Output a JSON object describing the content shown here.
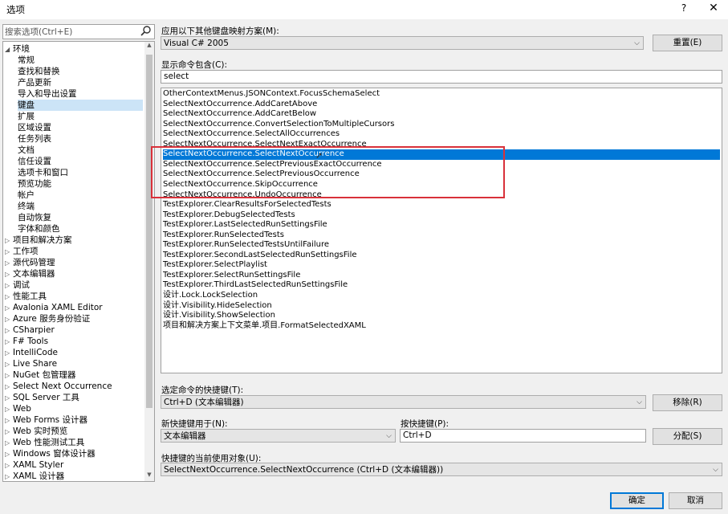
{
  "window": {
    "title": "选项",
    "help": "?",
    "close": "✕"
  },
  "search": {
    "placeholder": "搜索选项(Ctrl+E)",
    "value": "搜索选项(Ctrl+E)"
  },
  "tree": [
    {
      "label": "环境",
      "twisty": "◢",
      "indent": 0,
      "selected": false
    },
    {
      "label": "常规",
      "twisty": "",
      "indent": 1,
      "selected": false
    },
    {
      "label": "查找和替换",
      "twisty": "",
      "indent": 1,
      "selected": false
    },
    {
      "label": "产品更新",
      "twisty": "",
      "indent": 1,
      "selected": false
    },
    {
      "label": "导入和导出设置",
      "twisty": "",
      "indent": 1,
      "selected": false
    },
    {
      "label": "键盘",
      "twisty": "",
      "indent": 1,
      "selected": true
    },
    {
      "label": "扩展",
      "twisty": "",
      "indent": 1,
      "selected": false
    },
    {
      "label": "区域设置",
      "twisty": "",
      "indent": 1,
      "selected": false
    },
    {
      "label": "任务列表",
      "twisty": "",
      "indent": 1,
      "selected": false
    },
    {
      "label": "文档",
      "twisty": "",
      "indent": 1,
      "selected": false
    },
    {
      "label": "信任设置",
      "twisty": "",
      "indent": 1,
      "selected": false
    },
    {
      "label": "选项卡和窗口",
      "twisty": "",
      "indent": 1,
      "selected": false
    },
    {
      "label": "预览功能",
      "twisty": "",
      "indent": 1,
      "selected": false
    },
    {
      "label": "帐户",
      "twisty": "",
      "indent": 1,
      "selected": false
    },
    {
      "label": "终端",
      "twisty": "",
      "indent": 1,
      "selected": false
    },
    {
      "label": "自动恢复",
      "twisty": "",
      "indent": 1,
      "selected": false
    },
    {
      "label": "字体和颜色",
      "twisty": "",
      "indent": 1,
      "selected": false
    },
    {
      "label": "项目和解决方案",
      "twisty": "▷",
      "indent": 0,
      "selected": false
    },
    {
      "label": "工作项",
      "twisty": "▷",
      "indent": 0,
      "selected": false
    },
    {
      "label": "源代码管理",
      "twisty": "▷",
      "indent": 0,
      "selected": false
    },
    {
      "label": "文本编辑器",
      "twisty": "▷",
      "indent": 0,
      "selected": false
    },
    {
      "label": "调试",
      "twisty": "▷",
      "indent": 0,
      "selected": false
    },
    {
      "label": "性能工具",
      "twisty": "▷",
      "indent": 0,
      "selected": false
    },
    {
      "label": "Avalonia XAML Editor",
      "twisty": "▷",
      "indent": 0,
      "selected": false
    },
    {
      "label": "Azure 服务身份验证",
      "twisty": "▷",
      "indent": 0,
      "selected": false
    },
    {
      "label": "CSharpier",
      "twisty": "▷",
      "indent": 0,
      "selected": false
    },
    {
      "label": "F# Tools",
      "twisty": "▷",
      "indent": 0,
      "selected": false
    },
    {
      "label": "IntelliCode",
      "twisty": "▷",
      "indent": 0,
      "selected": false
    },
    {
      "label": "Live Share",
      "twisty": "▷",
      "indent": 0,
      "selected": false
    },
    {
      "label": "NuGet 包管理器",
      "twisty": "▷",
      "indent": 0,
      "selected": false
    },
    {
      "label": "Select Next Occurrence",
      "twisty": "▷",
      "indent": 0,
      "selected": false
    },
    {
      "label": "SQL Server 工具",
      "twisty": "▷",
      "indent": 0,
      "selected": false
    },
    {
      "label": "Web",
      "twisty": "▷",
      "indent": 0,
      "selected": false
    },
    {
      "label": "Web Forms 设计器",
      "twisty": "▷",
      "indent": 0,
      "selected": false
    },
    {
      "label": "Web 实时预览",
      "twisty": "▷",
      "indent": 0,
      "selected": false
    },
    {
      "label": "Web 性能测试工具",
      "twisty": "▷",
      "indent": 0,
      "selected": false
    },
    {
      "label": "Windows 窗体设计器",
      "twisty": "▷",
      "indent": 0,
      "selected": false
    },
    {
      "label": "XAML Styler",
      "twisty": "▷",
      "indent": 0,
      "selected": false
    },
    {
      "label": "XAML 设计器",
      "twisty": "▷",
      "indent": 0,
      "selected": false
    }
  ],
  "mapping": {
    "label": "应用以下其他键盘映射方案(M):",
    "value": "Visual C# 2005",
    "reset_label": "重置(E)"
  },
  "filter": {
    "label": "显示命令包含(C):",
    "value": "select"
  },
  "commands": [
    "OtherContextMenus.JSONContext.FocusSchemaSelect",
    "SelectNextOccurrence.AddCaretAbove",
    "SelectNextOccurrence.AddCaretBelow",
    "SelectNextOccurrence.ConvertSelectionToMultipleCursors",
    "SelectNextOccurrence.SelectAllOccurrences",
    "SelectNextOccurrence.SelectNextExactOccurrence",
    "SelectNextOccurrence.SelectNextOccurrence",
    "SelectNextOccurrence.SelectPreviousExactOccurrence",
    "SelectNextOccurrence.SelectPreviousOccurrence",
    "SelectNextOccurrence.SkipOccurrence",
    "SelectNextOccurrence.UndoOccurrence",
    "TestExplorer.ClearResultsForSelectedTests",
    "TestExplorer.DebugSelectedTests",
    "TestExplorer.LastSelectedRunSettingsFile",
    "TestExplorer.RunSelectedTests",
    "TestExplorer.RunSelectedTestsUntilFailure",
    "TestExplorer.SecondLastSelectedRunSettingsFile",
    "TestExplorer.SelectPlaylist",
    "TestExplorer.SelectRunSettingsFile",
    "TestExplorer.ThirdLastSelectedRunSettingsFile",
    "设计.Lock.LockSelection",
    "设计.Visibility.HideSelection",
    "设计.Visibility.ShowSelection",
    "项目和解决方案上下文菜单.项目.FormatSelectedXAML"
  ],
  "selected_command_index": 6,
  "shortcuts": {
    "label": "选定命令的快捷键(T):",
    "value": "Ctrl+D (文本编辑器)",
    "remove_label": "移除(R)"
  },
  "scope": {
    "label": "新快捷键用于(N):",
    "value": "文本编辑器"
  },
  "press": {
    "label": "按快捷键(P):",
    "value": "Ctrl+D",
    "assign_label": "分配(S)"
  },
  "current_use": {
    "label": "快捷键的当前使用对象(U):",
    "value": "SelectNextOccurrence.SelectNextOccurrence (Ctrl+D (文本编辑器))"
  },
  "footer": {
    "ok_label": "确定",
    "cancel_label": "取消"
  },
  "colors": {
    "selection": "#0078d7",
    "highlight_box": "#d9313a",
    "tree_selection": "#cce4f7"
  }
}
